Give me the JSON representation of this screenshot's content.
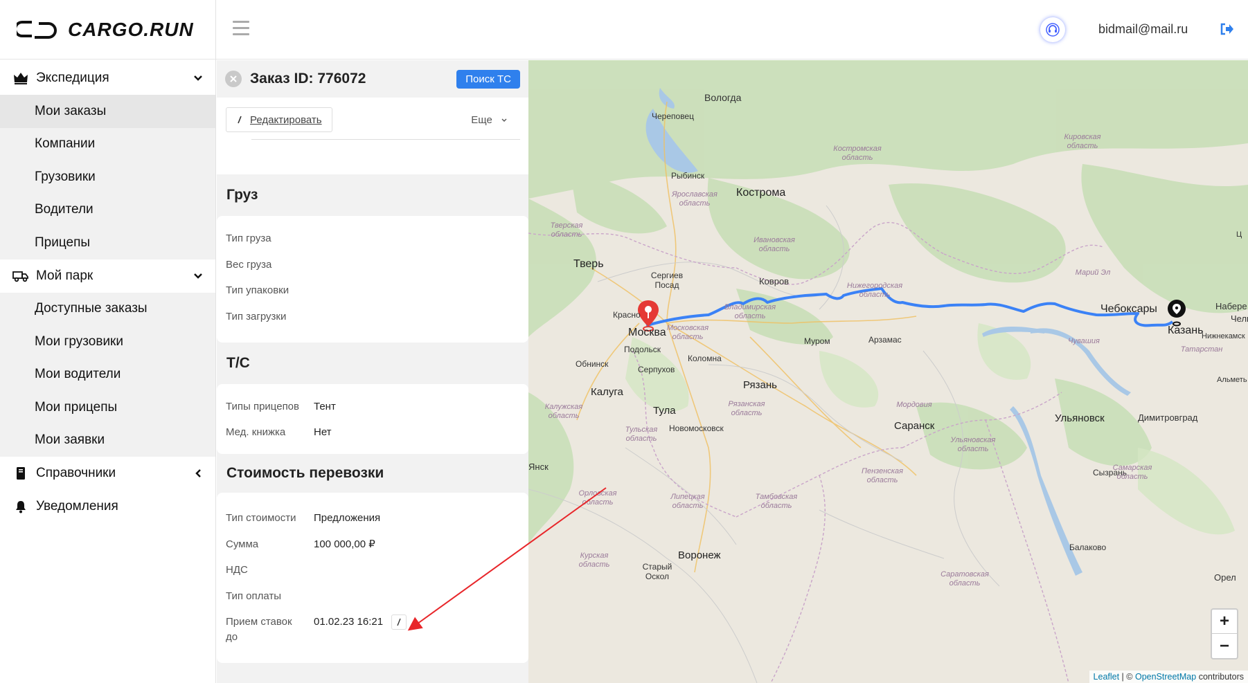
{
  "brand": {
    "name": "CARGO.RUN"
  },
  "header": {
    "email": "bidmail@mail.ru"
  },
  "sidebar": {
    "groups": [
      {
        "label": "Экспедиция",
        "icon": "crown-icon",
        "expanded": true,
        "items": [
          {
            "label": "Мои заказы",
            "active": true
          },
          {
            "label": "Компании"
          },
          {
            "label": "Грузовики"
          },
          {
            "label": "Водители"
          },
          {
            "label": "Прицепы"
          }
        ]
      },
      {
        "label": "Мой парк",
        "icon": "truck-icon",
        "expanded": true,
        "items": [
          {
            "label": "Доступные заказы"
          },
          {
            "label": "Мои грузовики"
          },
          {
            "label": "Мои водители"
          },
          {
            "label": "Мои прицепы"
          },
          {
            "label": "Мои заявки"
          }
        ]
      },
      {
        "label": "Справочники",
        "icon": "book-icon",
        "expanded": false
      },
      {
        "label": "Уведомления",
        "icon": "bell-icon"
      }
    ]
  },
  "order": {
    "title": "Заказ ID: 776072",
    "search_btn": "Поиск ТС",
    "edit_btn": "Редактировать",
    "more": "Еще",
    "cargo": {
      "title": "Груз",
      "rows": [
        {
          "k": "Тип груза",
          "v": ""
        },
        {
          "k": "Вес груза",
          "v": ""
        },
        {
          "k": "Тип упаковки",
          "v": ""
        },
        {
          "k": "Тип загрузки",
          "v": ""
        }
      ]
    },
    "vehicle": {
      "title": "Т/С",
      "rows": [
        {
          "k": "Типы прицепов",
          "v": "Тент"
        },
        {
          "k": "Мед. книжка",
          "v": "Нет"
        }
      ]
    },
    "cost": {
      "title": "Стоимость перевозки",
      "rows": [
        {
          "k": "Тип стоимости",
          "v": "Предложения"
        },
        {
          "k": "Сумма",
          "v": "100 000,00 ₽"
        },
        {
          "k": "НДС",
          "v": ""
        },
        {
          "k": "Тип оплаты",
          "v": ""
        },
        {
          "k": "Прием ставок до",
          "v": "01.02.23 16:21"
        }
      ]
    }
  },
  "map": {
    "cities": [
      "Вологда",
      "Череповец",
      "Рыбинск",
      "Кострома",
      "Тверь",
      "Сергиев Посад",
      "Ковров",
      "Красно",
      "Москва",
      "Подольск",
      "Обнинск",
      "Серпухов",
      "Коломна",
      "Муром",
      "Арзамас",
      "Чебоксары",
      "Казань",
      "Калуга",
      "Тула",
      "Рязань",
      "Новомосковск",
      "Саранск",
      "Ульяновск",
      "Димитровград",
      "Сызрань",
      "Воронеж",
      "Старый Оскол",
      "Балаково",
      "Набере",
      "Челн",
      "Нижнекамск",
      "Альметь",
      "Орел",
      "Янск",
      "Ц"
    ],
    "regions": [
      "Костромская область",
      "Кировская область",
      "Ярославская область",
      "Тверская область",
      "Ивановская область",
      "Нижегородская область",
      "Владимирская область",
      "Московская область",
      "Марий Эл",
      "Чувашия",
      "Татарстан",
      "Калужская область",
      "Рязанская область",
      "Мордовия",
      "Тульская область",
      "Ульяновская область",
      "Самарская область",
      "Пензенская область",
      "Орловская область",
      "Липецкая область",
      "Тамбовская область",
      "Курская область",
      "Саратовская область"
    ],
    "zoom_in": "+",
    "zoom_out": "−",
    "attribution": {
      "leaflet": "Leaflet",
      "sep": " | © ",
      "osm": "OpenStreetMap",
      "tail": " contributors"
    },
    "colors": {
      "route": "#3b82f6",
      "origin_marker": "#e53935",
      "dest_marker": "#111111",
      "annotation_arrow": "#e8262a"
    }
  }
}
